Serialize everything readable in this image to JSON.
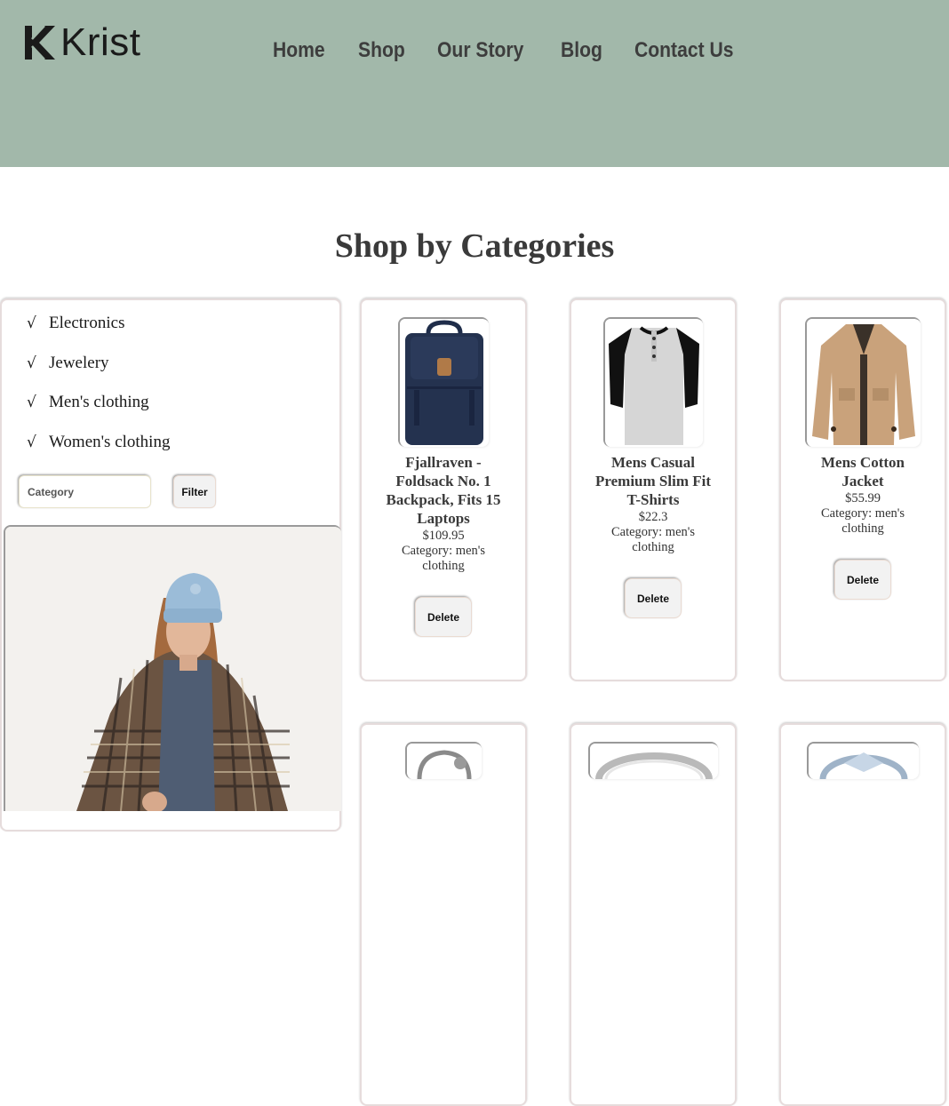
{
  "brand": {
    "name": "Krist"
  },
  "nav": {
    "items": [
      "Home",
      "Shop",
      "Our Story",
      "Blog",
      "Contact Us"
    ]
  },
  "page": {
    "title": "Shop by Categories"
  },
  "sidebar": {
    "categories": [
      "Electronics",
      "Jewelery",
      "Men's clothing",
      "Women's clothing"
    ],
    "check_glyph": "√",
    "input_placeholder": "Category",
    "filter_label": "Filter"
  },
  "products": [
    {
      "title": "Fjallraven - Foldsack No. 1 Backpack, Fits 15 Laptops",
      "price": "$109.95",
      "category": "Category: men's clothing",
      "delete_label": "Delete",
      "icon": "backpack-icon"
    },
    {
      "title": "Mens Casual Premium Slim Fit T-Shirts",
      "price": "$22.3",
      "category": "Category: men's clothing",
      "delete_label": "Delete",
      "icon": "tshirt-icon"
    },
    {
      "title": "Mens Cotton Jacket",
      "price": "$55.99",
      "category": "Category: men's clothing",
      "delete_label": "Delete",
      "icon": "jacket-icon"
    }
  ],
  "colors": {
    "header_bg": "#a2b8aa",
    "nav_text": "#3d3d3d",
    "title_text": "#3a3a3a"
  }
}
